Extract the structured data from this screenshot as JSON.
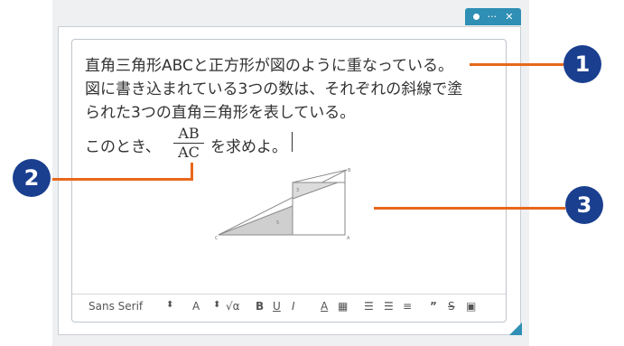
{
  "question": {
    "line1": "直角三角形ABCと正方形が図のように重なっている。",
    "line2": "図に書き込まれている3つの数は、それぞれの斜線で塗",
    "line3": "られた3つの直角三角形を表している。",
    "line4_before": "このとき、",
    "fraction_numerator": "AB",
    "fraction_denominator": "AC",
    "line4_after": "を求めよ。"
  },
  "figure": {
    "labels": {
      "c": "C",
      "a": "A",
      "b": "B",
      "top_num": "3",
      "left_num": "5"
    }
  },
  "toolbar": {
    "font_select": "Sans Serif",
    "font_size": "A",
    "formula": "√α",
    "bold": "B",
    "underline": "U",
    "italic": "I",
    "text_color": "A",
    "quote": "”",
    "strike": "S"
  },
  "window_controls": {
    "minimize": "···",
    "close": "✕"
  },
  "callouts": {
    "one": "1",
    "two": "2",
    "three": "3"
  },
  "colors": {
    "accent": "#2f8fb4",
    "callout": "#1a3f8f",
    "leader": "#e8681b"
  }
}
